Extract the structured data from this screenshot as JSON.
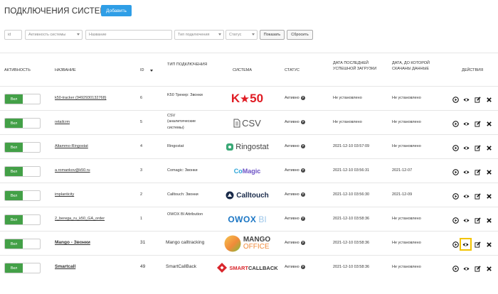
{
  "title": "ПОДКЛЮЧЕНИЯ СИСТЕМ",
  "add_button": "Добавить",
  "filters": {
    "id_placeholder": "id",
    "activity_placeholder": "Активность системы",
    "name_placeholder": "Название",
    "type_placeholder": "Тип подключения",
    "status_placeholder": "Статус",
    "show_button": "Показать",
    "reset_button": "Сбросить"
  },
  "columns": {
    "activity": "АКТИВНОСТЬ",
    "name": "НАЗВАНИЕ",
    "id": "ID",
    "type": "ТИП ПОДКЛЮЧЕНИЯ",
    "system": "СИСТЕМА",
    "status": "СТАТУС",
    "last_load": "ДАТА ПОСЛЕДНЕЙ УСПЕШНОЙ ЗАГРУЗКИ",
    "data_until": "ДАТА, ДО КОТОРОЙ СКАЧАНЫ ДАННЫЕ",
    "actions": "ДЕЙСТВИЯ"
  },
  "rows": [
    {
      "toggle": "Вкл",
      "name": "k50-tracker (9492930132768)",
      "id": "6",
      "type": "K50 Трекер: Звонки",
      "system_logo": "K50",
      "status": "Активно",
      "last_load": "Не установлено",
      "data_until": "Не установлено"
    },
    {
      "toggle": "Вкл",
      "name": "retailcrm",
      "id": "5",
      "type": "CSV (аналитические системы)",
      "system_logo": "CSV",
      "status": "Активно",
      "last_load": "Не установлено",
      "data_until": "Не установлено"
    },
    {
      "toggle": "Вкл",
      "name": "Altammo-Ringostat",
      "id": "4",
      "type": "Ringostat",
      "system_logo": "Ringostat",
      "status": "Активно",
      "last_load": "2021-12-10 03:57:09",
      "data_until": "Не установлено"
    },
    {
      "toggle": "Вкл",
      "name": "a.romankov@k50.ru",
      "id": "3",
      "type": "Comagic: Звонки",
      "system_logo": "CoMagic",
      "status": "Активно",
      "last_load": "2021-12-10 03:56:31",
      "data_until": "2021-12-07"
    },
    {
      "toggle": "Вкл",
      "name": "implanticity",
      "id": "2",
      "type": "Calltouch: Звонки",
      "system_logo": "Calltouch",
      "status": "Активно",
      "last_load": "2021-12-10 03:56:30",
      "data_until": "2021-12-09"
    },
    {
      "toggle": "Вкл",
      "name": "2_berega_ru_k50_GA_order",
      "id": "1",
      "type": "OWOX BI Attribution",
      "system_logo": "OWOX BI",
      "status": "Активно",
      "last_load": "2021-12-10 03:58:36",
      "data_until": "Не установлено"
    },
    {
      "toggle": "Вкл",
      "name": "Mango - Звонки",
      "id": "31",
      "type": "Mango calltracking",
      "system_logo": "MANGO OFFICE",
      "status": "Активно",
      "last_load": "2021-12-10 03:58:36",
      "data_until": "Не установлено"
    },
    {
      "toggle": "Вкл",
      "name": "Smartcall",
      "id": "49",
      "type": "SmartCallBack",
      "system_logo": "SMARTCALLBACK",
      "status": "Активно",
      "last_load": "2021-12-10 03:58:36",
      "data_until": "Не установлено"
    }
  ],
  "logos": {
    "k50_k": "K",
    "k50_num": "50",
    "csv_text": "CSV",
    "ringostat_text": "Ringostat",
    "comagic_co": "Co",
    "comagic_magic": "Magic",
    "calltouch_text": "Calltouch",
    "owox_text": "OWOX",
    "owox_bi": "BI",
    "mango_top": "MANGO",
    "mango_bottom": "OFFICE",
    "smart_text": "SMART",
    "smart_callback": "CALLBACK"
  },
  "q_mark": "?",
  "colors": {
    "accent": "#2f9ee6",
    "toggle_on": "#43a047",
    "highlight": "#f2c300",
    "k50_red": "#e01c24"
  },
  "highlighted_action": "view-icon (row Mango - Звонки)"
}
